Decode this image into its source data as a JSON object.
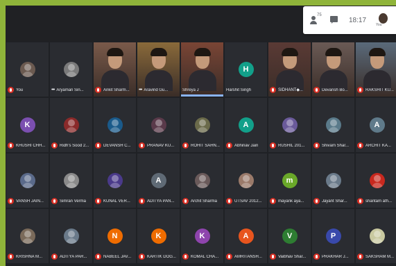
{
  "status": {
    "participant_count": "75",
    "time": "18:17",
    "you_label": "You"
  },
  "tiles": [
    {
      "name": "You",
      "kind": "photo",
      "color": "#6b5a50",
      "mic": "off"
    },
    {
      "name": "Aryaman Sin...",
      "kind": "photo",
      "color": "#7a7a7a",
      "mic": "dots"
    },
    {
      "name": "Ankit Sharm...",
      "kind": "video",
      "color": "#7a5a4a",
      "mic": "off"
    },
    {
      "name": "Aravind Gu...",
      "kind": "video",
      "color": "#8a6a3a",
      "mic": "dots"
    },
    {
      "name": "Shreya J",
      "kind": "video",
      "color": "#7a4535",
      "mic": "none",
      "speaking": true
    },
    {
      "name": "Harshit Singh",
      "kind": "letter",
      "letter": "H",
      "color": "#12a08a",
      "mic": "none"
    },
    {
      "name": "SIDHANT◆...",
      "kind": "video",
      "color": "#5a3a35",
      "mic": "off"
    },
    {
      "name": "Devansh Bo...",
      "kind": "video",
      "color": "#6a5a55",
      "mic": "off"
    },
    {
      "name": "RAKSHIT KU...",
      "kind": "video",
      "color": "#5a6a7a",
      "mic": "off"
    },
    {
      "name": "KHUSHI CHH...",
      "kind": "letter",
      "letter": "K",
      "color": "#7b4fb0",
      "mic": "off"
    },
    {
      "name": "Ridh's Sood 2...",
      "kind": "photo",
      "color": "#8a2a2a",
      "mic": "off"
    },
    {
      "name": "DEVANSH C...",
      "kind": "photo",
      "color": "#1a5a8a",
      "mic": "off"
    },
    {
      "name": "PRANAV KU...",
      "kind": "photo",
      "color": "#5a3a4a",
      "mic": "off"
    },
    {
      "name": "ROHIT SAHN...",
      "kind": "photo",
      "color": "#6a6a4a",
      "mic": "off"
    },
    {
      "name": "Abhinav Jain",
      "kind": "letter",
      "letter": "A",
      "color": "#12a08a",
      "mic": "off"
    },
    {
      "name": "RUSHIL 201...",
      "kind": "photo",
      "color": "#6a5a9a",
      "mic": "off"
    },
    {
      "name": "Shivam Shar...",
      "kind": "photo",
      "color": "#5a7a8a",
      "mic": "off"
    },
    {
      "name": "ARCHIT KA...",
      "kind": "letter",
      "letter": "A",
      "color": "#5f7a8a",
      "mic": "off"
    },
    {
      "name": "VANSH JAIN...",
      "kind": "photo",
      "color": "#5a6a8a",
      "mic": "off"
    },
    {
      "name": "Simran Verma",
      "kind": "photo",
      "color": "#8a8a8a",
      "mic": "off"
    },
    {
      "name": "KUNAL VER...",
      "kind": "photo",
      "color": "#4a3a8a",
      "mic": "off"
    },
    {
      "name": "ADITYA PAN...",
      "kind": "letter",
      "letter": "A",
      "color": "#5f6a75",
      "mic": "off"
    },
    {
      "name": "Archit Sharma",
      "kind": "photo",
      "color": "#6a5a5a",
      "mic": "off"
    },
    {
      "name": "UTSAV 2012...",
      "kind": "photo",
      "color": "#9a7a6a",
      "mic": "off"
    },
    {
      "name": "mayank aya...",
      "kind": "letter",
      "letter": "m",
      "color": "#6aa829",
      "mic": "off"
    },
    {
      "name": "Jayant Shar...",
      "kind": "photo",
      "color": "#6a7a8a",
      "mic": "off"
    },
    {
      "name": "shantam ath...",
      "kind": "photo",
      "color": "#c8281e",
      "mic": "off"
    },
    {
      "name": "KRISHNA M...",
      "kind": "photo",
      "color": "#7a6a5a",
      "mic": "off"
    },
    {
      "name": "ADITYA PAR...",
      "kind": "photo",
      "color": "#6a7a8a",
      "mic": "off"
    },
    {
      "name": "NABEEL JAV...",
      "kind": "letter",
      "letter": "N",
      "color": "#ef6c00",
      "mic": "off"
    },
    {
      "name": "KARTIK DOG...",
      "kind": "letter",
      "letter": "K",
      "color": "#ef6c00",
      "mic": "off"
    },
    {
      "name": "KOMAL CHA...",
      "kind": "letter",
      "letter": "K",
      "color": "#8e44ad",
      "mic": "off"
    },
    {
      "name": "AMRITANSH...",
      "kind": "letter",
      "letter": "A",
      "color": "#e8551e",
      "mic": "off"
    },
    {
      "name": "Vaibhav Shar...",
      "kind": "letter",
      "letter": "V",
      "color": "#2e7d32",
      "mic": "off"
    },
    {
      "name": "PRAKHAR J...",
      "kind": "letter",
      "letter": "P",
      "color": "#3949ab",
      "mic": "off"
    },
    {
      "name": "SAKSHAM M...",
      "kind": "photo",
      "color": "#c9c9a0",
      "mic": "off"
    }
  ]
}
